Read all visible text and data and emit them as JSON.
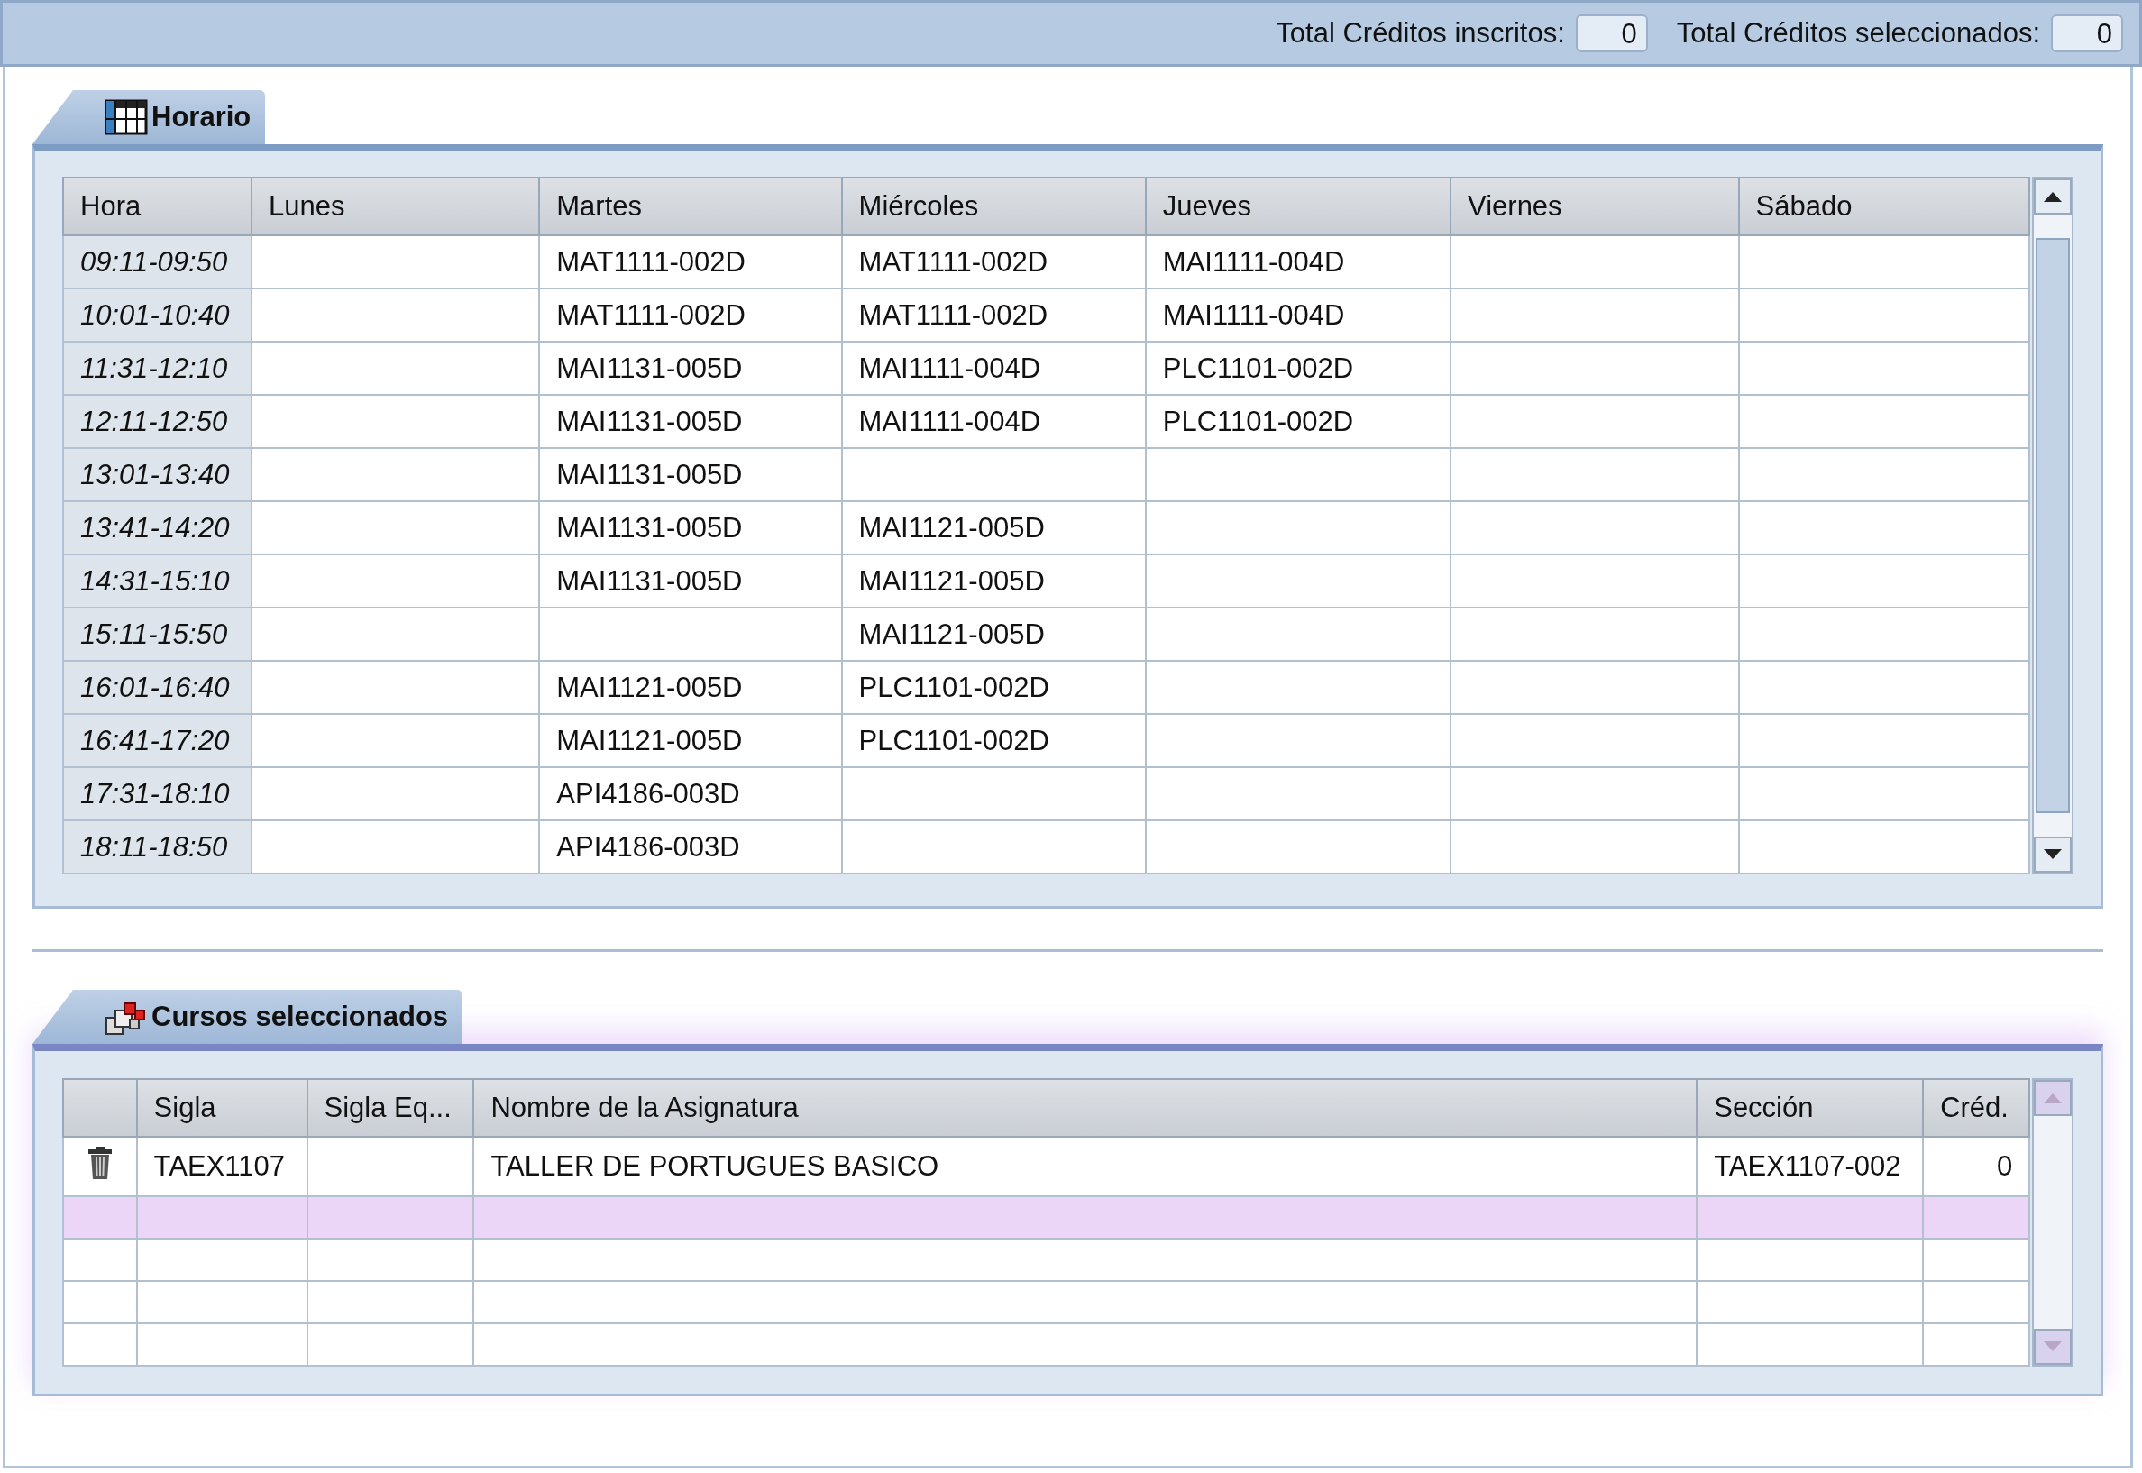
{
  "totals": [
    {
      "label": "Total Créditos inscritos:",
      "value": "0"
    },
    {
      "label": "Total Créditos seleccionados:",
      "value": "0"
    }
  ],
  "schedule": {
    "tab": {
      "label": "Horario",
      "selected": true
    },
    "columns": [
      "Hora",
      "Lunes",
      "Martes",
      "Miércoles",
      "Jueves",
      "Viernes",
      "Sábado"
    ],
    "rows": [
      [
        "09:11-09:50",
        "",
        "MAT1111-002D",
        "MAT1111-002D",
        "MAI1111-004D",
        "",
        ""
      ],
      [
        "10:01-10:40",
        "",
        "MAT1111-002D",
        "MAT1111-002D",
        "MAI1111-004D",
        "",
        ""
      ],
      [
        "11:31-12:10",
        "",
        "MAI1131-005D",
        "MAI1111-004D",
        "PLC1101-002D",
        "",
        ""
      ],
      [
        "12:11-12:50",
        "",
        "MAI1131-005D",
        "MAI1111-004D",
        "PLC1101-002D",
        "",
        ""
      ],
      [
        "13:01-13:40",
        "",
        "MAI1131-005D",
        "",
        "",
        "",
        ""
      ],
      [
        "13:41-14:20",
        "",
        "MAI1131-005D",
        "MAI1121-005D",
        "",
        "",
        ""
      ],
      [
        "14:31-15:10",
        "",
        "MAI1131-005D",
        "MAI1121-005D",
        "",
        "",
        ""
      ],
      [
        "15:11-15:50",
        "",
        "",
        "MAI1121-005D",
        "",
        "",
        ""
      ],
      [
        "16:01-16:40",
        "",
        "MAI1121-005D",
        "PLC1101-002D",
        "",
        "",
        ""
      ],
      [
        "16:41-17:20",
        "",
        "MAI1121-005D",
        "PLC1101-002D",
        "",
        "",
        ""
      ],
      [
        "17:31-18:10",
        "",
        "API4186-003D",
        "",
        "",
        "",
        ""
      ],
      [
        "18:11-18:50",
        "",
        "API4186-003D",
        "",
        "",
        "",
        ""
      ]
    ]
  },
  "courses": {
    "tab": {
      "label": "Cursos seleccionados",
      "selected": true
    },
    "columns": [
      "",
      "Sigla",
      "Sigla Eq...",
      "Nombre de la Asignatura",
      "Sección",
      "Créd."
    ],
    "rows": [
      {
        "sigla": "TAEX1107",
        "sigla_eq": "",
        "nombre": "TALLER DE PORTUGUES BASICO",
        "seccion": "TAEX1107-002",
        "creditos": "0"
      }
    ]
  }
}
